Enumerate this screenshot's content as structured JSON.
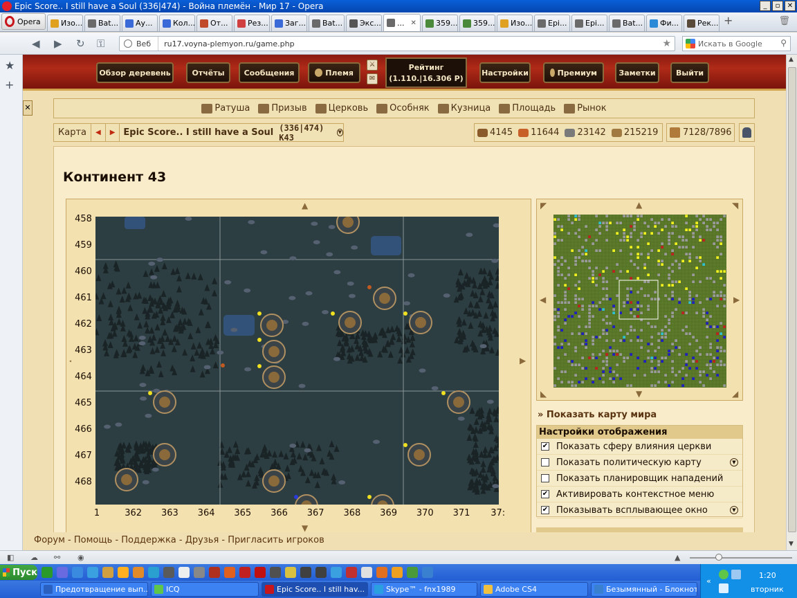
{
  "window": {
    "title": "Epic Score.. I still have a Soul (336|474) - Война племён - Мир 17 - Opera"
  },
  "browser": {
    "menu_label": "Opera",
    "tabs": [
      {
        "label": "Изо..."
      },
      {
        "label": "Bat..."
      },
      {
        "label": "Ау..."
      },
      {
        "label": "Кол..."
      },
      {
        "label": "От..."
      },
      {
        "label": "Рез..."
      },
      {
        "label": "Заг..."
      },
      {
        "label": "Bat..."
      },
      {
        "label": "Экс..."
      },
      {
        "label": "...",
        "active": true
      },
      {
        "label": "359..."
      },
      {
        "label": "359..."
      },
      {
        "label": "Изо..."
      },
      {
        "label": "Epi..."
      },
      {
        "label": "Epi..."
      },
      {
        "label": "Bat..."
      },
      {
        "label": "Фи..."
      },
      {
        "label": "Рек..."
      }
    ],
    "address_mode": "Веб",
    "url": "ru17.voyna-plemyon.ru/game.php",
    "search_placeholder": "Искать в Google"
  },
  "game": {
    "top_menu": {
      "overview": "Обзор деревень",
      "reports": "Отчёты",
      "messages": "Сообщения",
      "tribe": "Племя",
      "rating_label": "Рейтинг",
      "rating_value": "(1.110.|16.306 Р)",
      "settings": "Настройки",
      "premium": "Премиум",
      "notes": "Заметки",
      "logout": "Выйти"
    },
    "buildings": [
      {
        "label": "Ратуша"
      },
      {
        "label": "Призыв"
      },
      {
        "label": "Церковь"
      },
      {
        "label": "Особняк"
      },
      {
        "label": "Кузница"
      },
      {
        "label": "Площадь"
      },
      {
        "label": "Рынок"
      }
    ],
    "infobar": {
      "map_label": "Карта",
      "village_name": "Epic Score.. I still have a Soul",
      "coords": "(336|474) K43"
    },
    "resources": {
      "wood": "4145",
      "clay": "11644",
      "iron": "23142",
      "storage": "215219",
      "population": "7128/7896"
    },
    "page_heading": "Континент 43",
    "map": {
      "y_labels": [
        "458",
        "459",
        "460",
        "461",
        "462",
        "463",
        "464",
        "465",
        "466",
        "467",
        "468"
      ],
      "x_labels": [
        "1",
        "362",
        "363",
        "364",
        "365",
        "366",
        "367",
        "368",
        "369",
        "370",
        "371",
        "37:"
      ]
    },
    "show_world_map": "» Показать карту мира",
    "display_settings": {
      "title": "Настройки отображения",
      "options": [
        {
          "label": "Показать сферу влияния церкви",
          "checked": true
        },
        {
          "label": "Показать политическую карту",
          "checked": false
        },
        {
          "label": "Показать планировщик нападений",
          "checked": false
        },
        {
          "label": "Активировать контекстное меню",
          "checked": true
        },
        {
          "label": "Показывать всплывающее окно",
          "checked": true
        }
      ]
    },
    "footer": {
      "forum": "Форум",
      "help": "Помощь",
      "support": "Поддержка",
      "friends": "Друзья",
      "invite": "Пригласить игроков",
      "sep": "-"
    }
  },
  "taskbar": {
    "start": "Пуск",
    "tasks": [
      {
        "label": "Предотвращение вып..."
      },
      {
        "label": "ICQ"
      },
      {
        "label": "Epic Score.. I still hav...",
        "active": true
      },
      {
        "label": "Skype™ - fnx1989"
      },
      {
        "label": "Adobe CS4"
      },
      {
        "label": "Безымянный - Блокнот"
      }
    ],
    "clock": "1:20",
    "day": "вторник"
  },
  "colors": {
    "topbar": "#b02a18",
    "panel": "#f1e2b6",
    "map_bg": "#2c3d41",
    "minimap_bg": "#5c7a2a"
  }
}
